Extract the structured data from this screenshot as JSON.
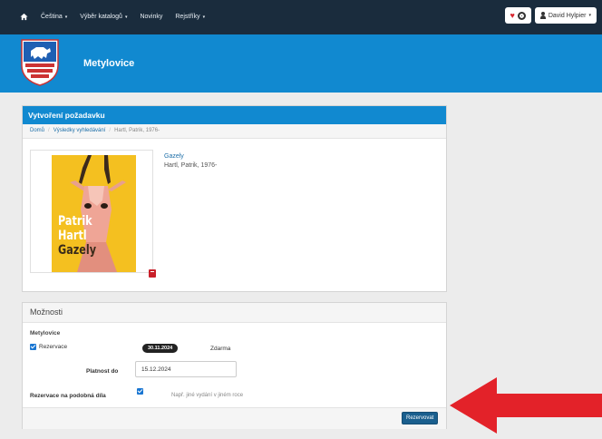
{
  "navbar": {
    "items": [
      "Čeština",
      "Výběr katalogů",
      "Novinky",
      "Rejstříky"
    ],
    "user_name": "David Hylpier"
  },
  "header": {
    "library_name": "Metylovice"
  },
  "request": {
    "title": "Vytvoření požadavku",
    "breadcrumb": {
      "home": "Domů",
      "results": "Výsledky vyhledávání",
      "current": "Hartl, Patrik, 1976-"
    },
    "record_title": "Gazely",
    "record_author": "Hartl, Patrik, 1976-",
    "cover": {
      "line1": "Patrik",
      "line2": "Hartl",
      "line3": "Gazely"
    }
  },
  "options": {
    "title": "Možnosti",
    "location": "Metylovice",
    "reservation_label": "Rezervace",
    "reservation_date": "30.11.2024",
    "price": "Zdarma",
    "valid_until_label": "Platnost do",
    "valid_until_value": "15.12.2024",
    "similar_label": "Rezervace na podobná díla",
    "similar_hint": "Např. jiné vydání v jiném roce",
    "reserve_button": "Rezervovat"
  },
  "colors": {
    "navbar": "#1a2c3d",
    "header": "#1189d0",
    "button": "#1a5f8e",
    "arrow": "#e32229",
    "cover": "#f4c020"
  }
}
